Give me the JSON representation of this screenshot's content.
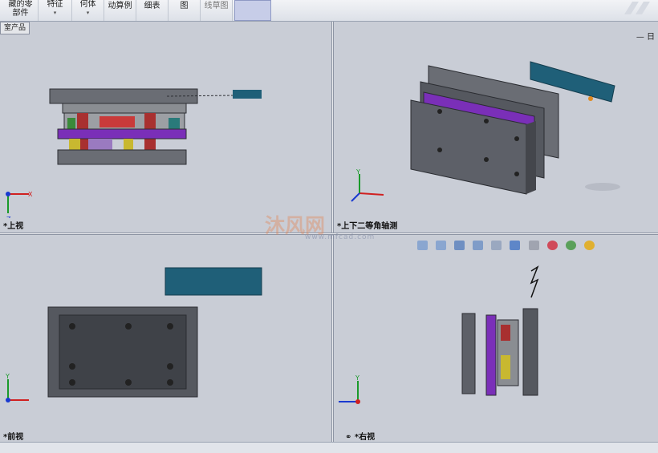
{
  "toolbar": {
    "buttons": [
      {
        "label": "藏的零\n部件",
        "arrow": ""
      },
      {
        "label": "特征",
        "arrow": "▾"
      },
      {
        "label": "何体",
        "arrow": "▾"
      },
      {
        "label": "动算例",
        "arrow": ""
      },
      {
        "label": "细表",
        "arrow": ""
      },
      {
        "label": "图",
        "arrow": ""
      },
      {
        "label": "线草图",
        "arrow": ""
      }
    ]
  },
  "tab_tag": "室产品",
  "views": {
    "top_left": "*上视",
    "top_right": "*上下二等角轴测",
    "bottom_left": "*前视",
    "bottom_right": "*右视"
  },
  "watermark": {
    "main": "沐风网",
    "sub": "www.mfcad.com"
  },
  "pane_controls": "— 日",
  "colors": {
    "viewport_bg": "#c9cdd6",
    "plate_gray": "#5d6068",
    "plate_purple": "#7a2fb8",
    "strip_teal": "#1f5f78",
    "axis_x": "#d02020",
    "axis_y": "#1a9a2a",
    "axis_z": "#1a3ad0"
  },
  "axes": {
    "x": "X",
    "y": "Y",
    "z": "Z"
  }
}
